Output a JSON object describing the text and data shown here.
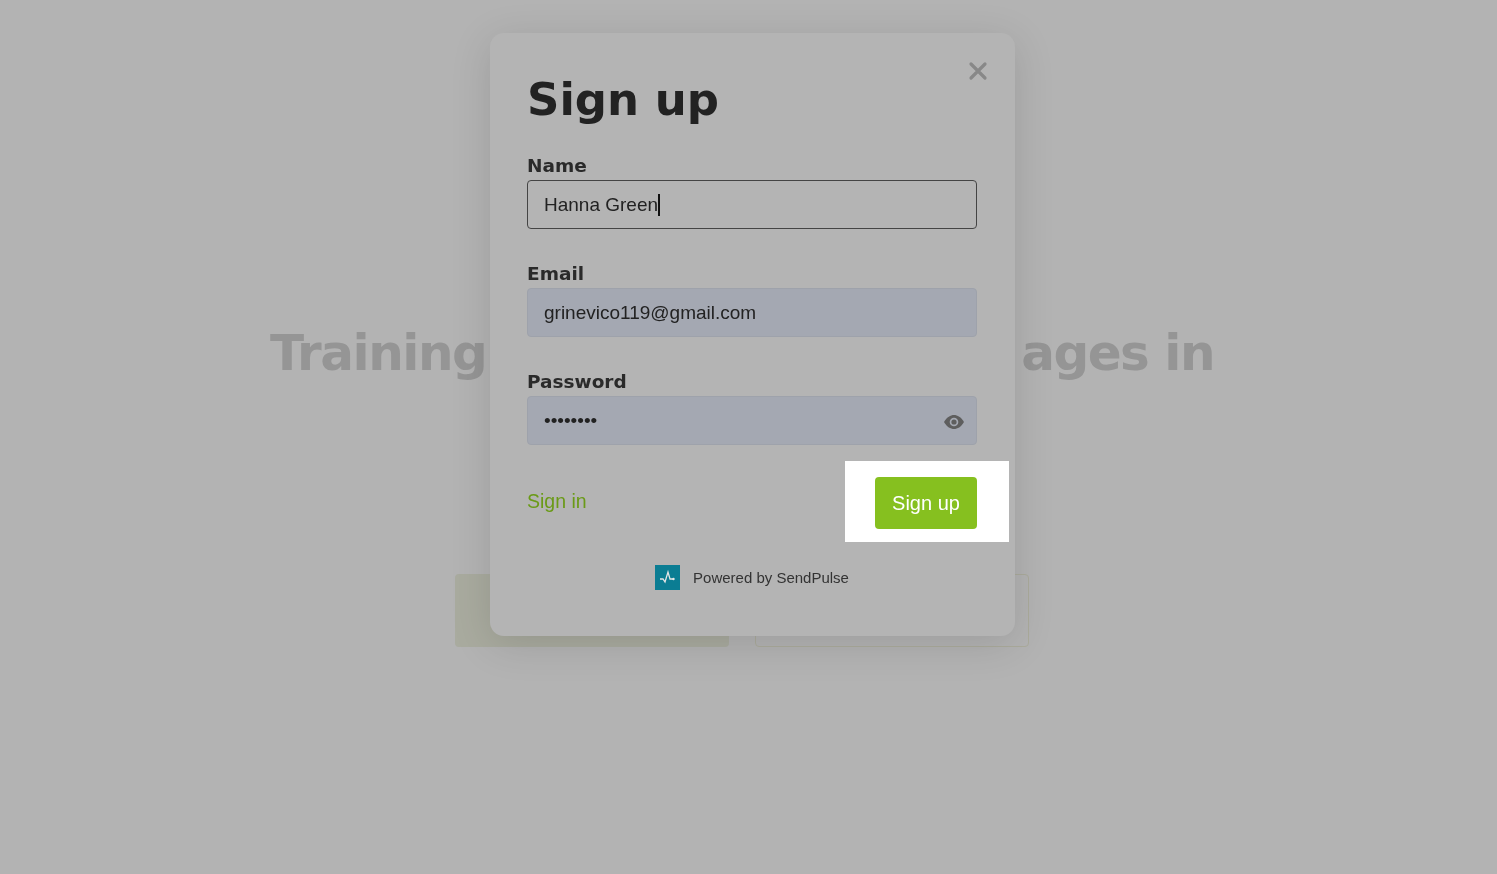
{
  "background": {
    "headline_left": "Training",
    "headline_right": "ages in"
  },
  "dialog": {
    "title": "Sign up",
    "fields": [
      {
        "label": "Name",
        "value": "Hanna Green",
        "focused": true,
        "autofilled": false
      },
      {
        "label": "Email",
        "value": "grinevico119@gmail.com",
        "focused": false,
        "autofilled": true
      },
      {
        "label": "Password",
        "value": "••••••••",
        "focused": false,
        "autofilled": true,
        "kind": "password"
      }
    ],
    "sign_in_link": "Sign in",
    "submit_button": {
      "label": "Sign up",
      "highlighted": true
    },
    "footer": "Powered by SendPulse"
  }
}
